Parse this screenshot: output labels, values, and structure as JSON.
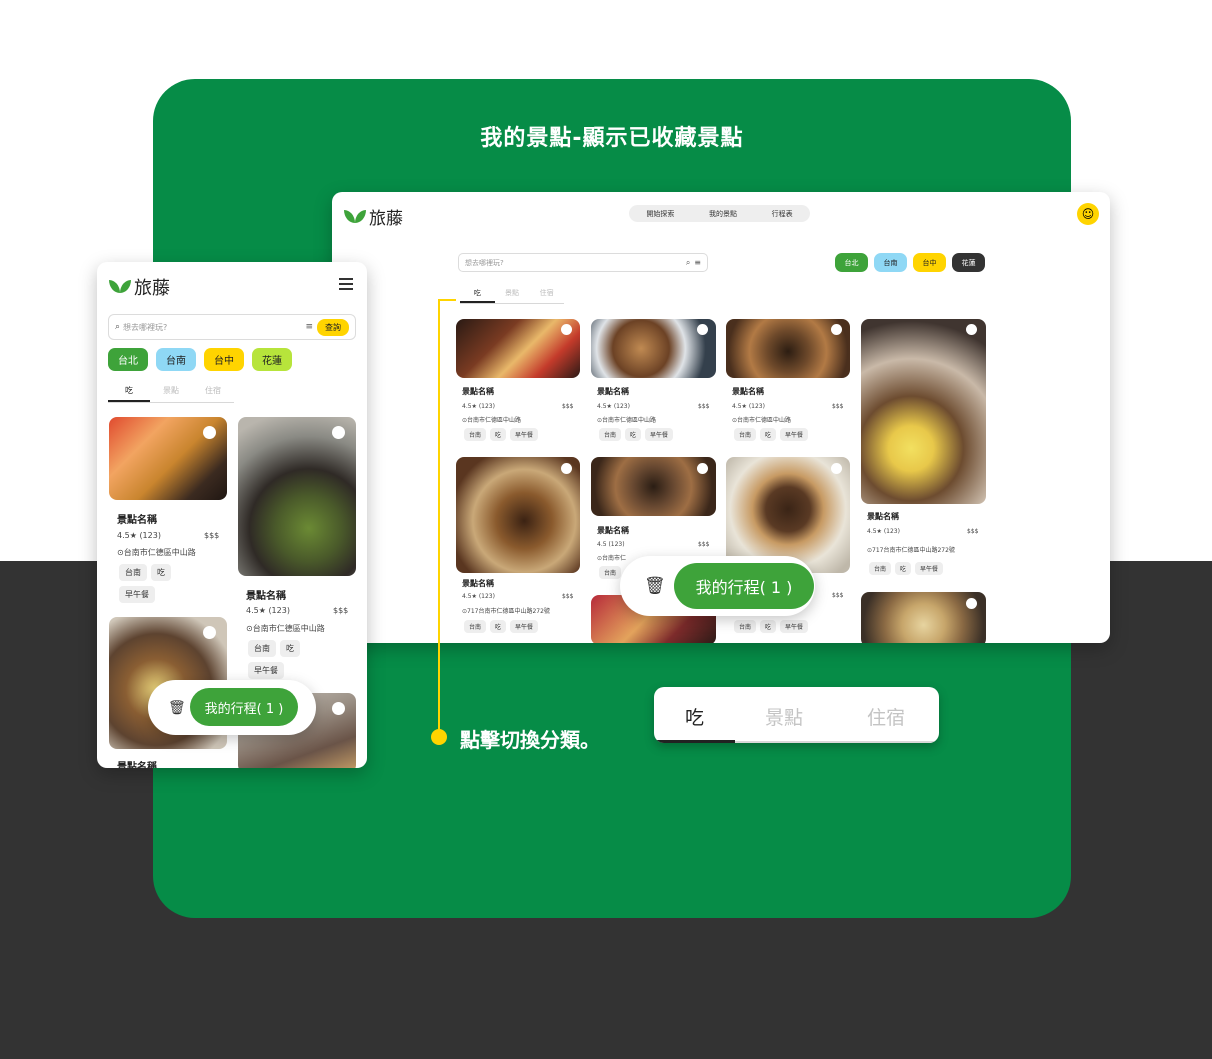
{
  "hero": {
    "title": "我的景點-顯示已收藏景點"
  },
  "brand": {
    "name": "旅藤"
  },
  "desktop": {
    "nav": [
      "開始探索",
      "我的景點",
      "行程表"
    ],
    "search_placeholder": "想去哪裡玩?",
    "chips": [
      "台北",
      "台南",
      "台中",
      "花蓮"
    ],
    "tabs": [
      "吃",
      "景點",
      "住宿"
    ],
    "cards": [
      {
        "name": "景點名稱",
        "rating": "4.5★ (123)",
        "price": "$$$",
        "address": "台南市仁德區中山路",
        "tags": [
          "台南",
          "吃",
          "早午餐"
        ]
      },
      {
        "name": "景點名稱",
        "rating": "4.5★ (123)",
        "price": "$$$",
        "address": "台南市仁德區中山路",
        "tags": [
          "台南",
          "吃",
          "早午餐"
        ]
      },
      {
        "name": "景點名稱",
        "rating": "4.5★ (123)",
        "price": "$$$",
        "address": "台南市仁德區中山路",
        "tags": [
          "台南",
          "吃",
          "早午餐"
        ]
      },
      {
        "name": "景點名稱",
        "rating": "4.5★ (123)",
        "price": "$$$",
        "address": "717台南市仁德區中山路272號",
        "tags": [
          "台南",
          "吃",
          "早午餐"
        ]
      },
      {
        "name": "景點名稱",
        "rating": "4.5★ (123)",
        "price": "$$$",
        "address": "717台南市仁德區中山路272號",
        "tags": [
          "台南",
          "吃",
          "早午餐"
        ]
      },
      {
        "name": "景點名稱",
        "rating": "4.5 (123)",
        "price": "$$$",
        "address": "台南市仁",
        "tags": [
          "台南"
        ]
      },
      {
        "name": "",
        "rating": "",
        "price": "$$$",
        "address": "",
        "tags": [
          "台南",
          "吃",
          "早午餐"
        ]
      }
    ],
    "trip_button": "我的行程( 1 )"
  },
  "mobile": {
    "search_placeholder": "想去哪裡玩?",
    "search_button": "查詢",
    "chips": [
      "台北",
      "台南",
      "台中",
      "花蓮"
    ],
    "tabs": [
      "吃",
      "景點",
      "住宿"
    ],
    "cards": [
      {
        "name": "景點名稱",
        "rating": "4.5★ (123)",
        "price": "$$$",
        "address": "台南市仁德區中山路",
        "tags": [
          "台南",
          "吃",
          "早午餐"
        ]
      },
      {
        "name": "景點名稱",
        "rating": "4.5★ (123)",
        "price": "$$$",
        "address": "台南市仁德區中山路",
        "tags": [
          "台南",
          "吃",
          "早午餐"
        ]
      },
      {
        "name": "景點名稱"
      }
    ],
    "trip_button": "我的行程( 1 )"
  },
  "callout": {
    "text": "點擊切換分類。",
    "tabs": [
      "吃",
      "景點",
      "住宿"
    ]
  },
  "colors": {
    "panel_green": "#068c47",
    "brand_green": "#3ea33a",
    "chip_blue": "#8fd8f5",
    "chip_yellow": "#ffd400",
    "chip_dark": "#333333",
    "chip_lime": "#b7e43b",
    "background_dark": "#333333"
  },
  "icons": [
    "leaf-logo-icon",
    "search-icon",
    "sort-icon",
    "trash-icon",
    "menu-icon",
    "avatar-icon",
    "favorite-dot-icon",
    "location-pin-icon"
  ]
}
